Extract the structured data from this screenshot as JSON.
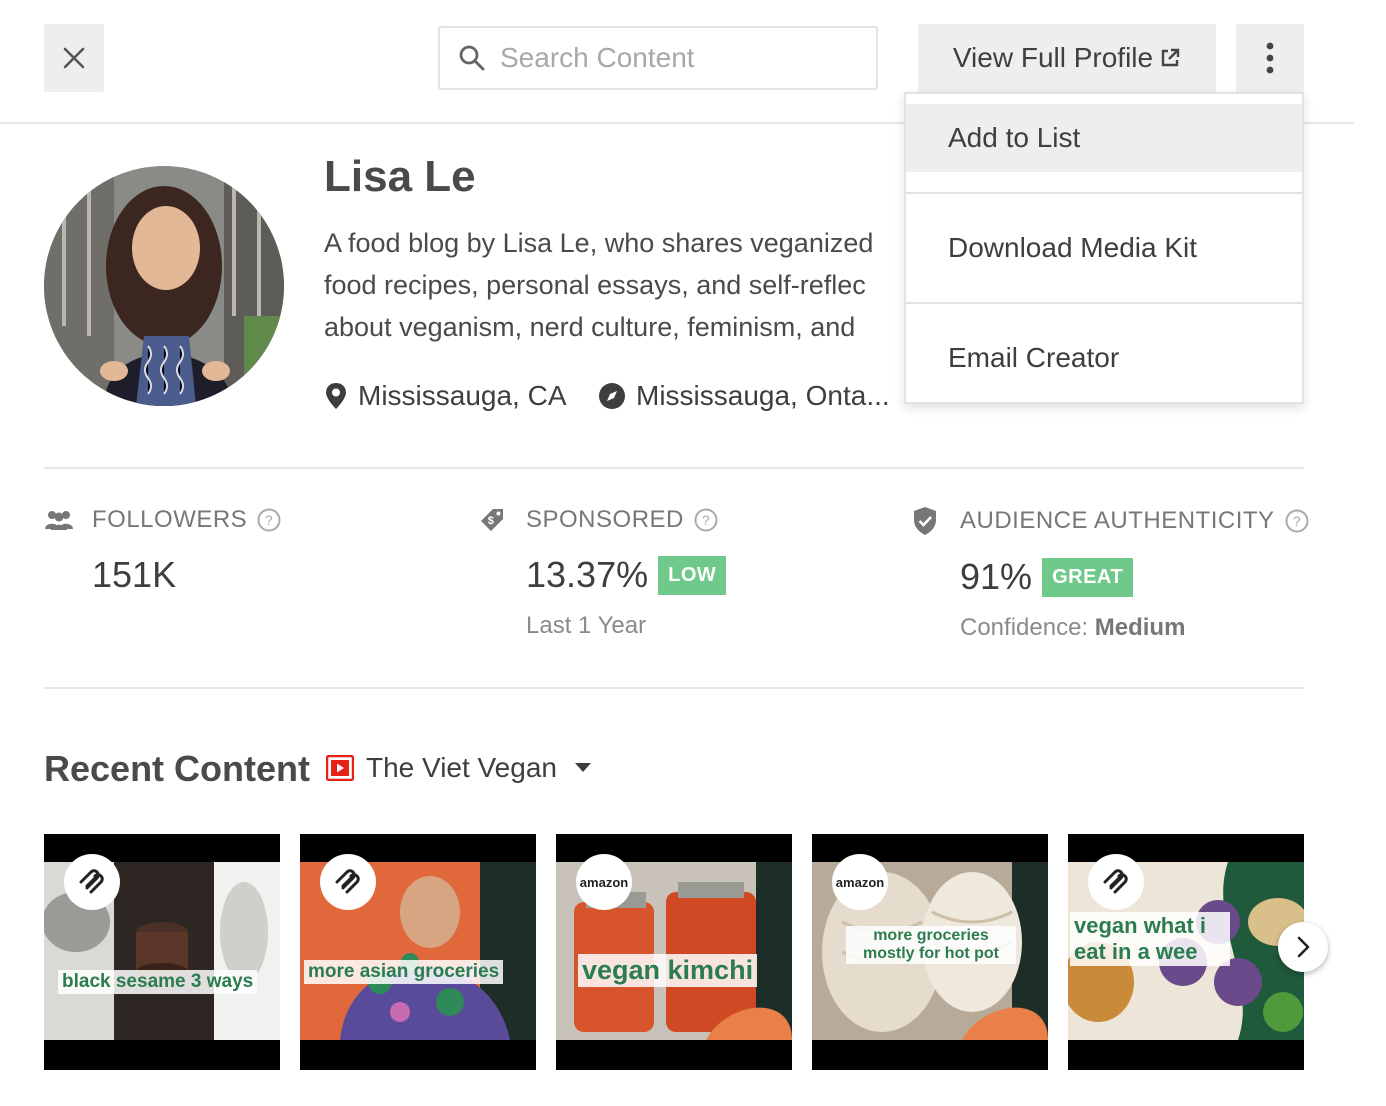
{
  "header": {
    "search_placeholder": "Search Content",
    "view_profile_label": "View Full Profile"
  },
  "menu": {
    "items": [
      {
        "label": "Add to List"
      },
      {
        "label": "Download Media Kit"
      },
      {
        "label": "Email Creator"
      }
    ]
  },
  "profile": {
    "name": "Lisa Le",
    "bio_lines": [
      "A food blog by Lisa Le, who shares veganized",
      "food recipes, personal essays, and self-reflec",
      "about veganism, nerd culture, feminism, and"
    ],
    "location": "Mississauga, CA",
    "hometown": "Mississauga, Onta..."
  },
  "stats": {
    "followers": {
      "label": "FOLLOWERS",
      "value": "151K"
    },
    "sponsored": {
      "label": "SPONSORED",
      "value": "13.37%",
      "badge": "LOW",
      "sub": "Last 1 Year"
    },
    "authenticity": {
      "label": "AUDIENCE AUTHENTICITY",
      "value": "91%",
      "badge": "GREAT",
      "sub_prefix": "Confidence: ",
      "sub_value": "Medium"
    }
  },
  "recent": {
    "title": "Recent Content",
    "channel": "The Viet Vegan",
    "thumbnails": [
      {
        "caption": "black sesame 3 ways",
        "sponsor": "squarespace-icon"
      },
      {
        "caption": "more asian groceries",
        "sponsor": "squarespace-icon"
      },
      {
        "caption": "vegan kimchi",
        "sponsor": "amazon",
        "sponsor_text": "amazon"
      },
      {
        "caption": "more groceries mostly for hot pot",
        "sponsor": "amazon",
        "sponsor_text": "amazon"
      },
      {
        "caption": "vegan what i eat in a wee",
        "sponsor": "squarespace-icon"
      }
    ]
  },
  "colors": {
    "badge_green": "#6fc98a",
    "button_bg": "#eeeeee",
    "youtube_red": "#e62117",
    "caption_green": "#2b7d4f"
  }
}
